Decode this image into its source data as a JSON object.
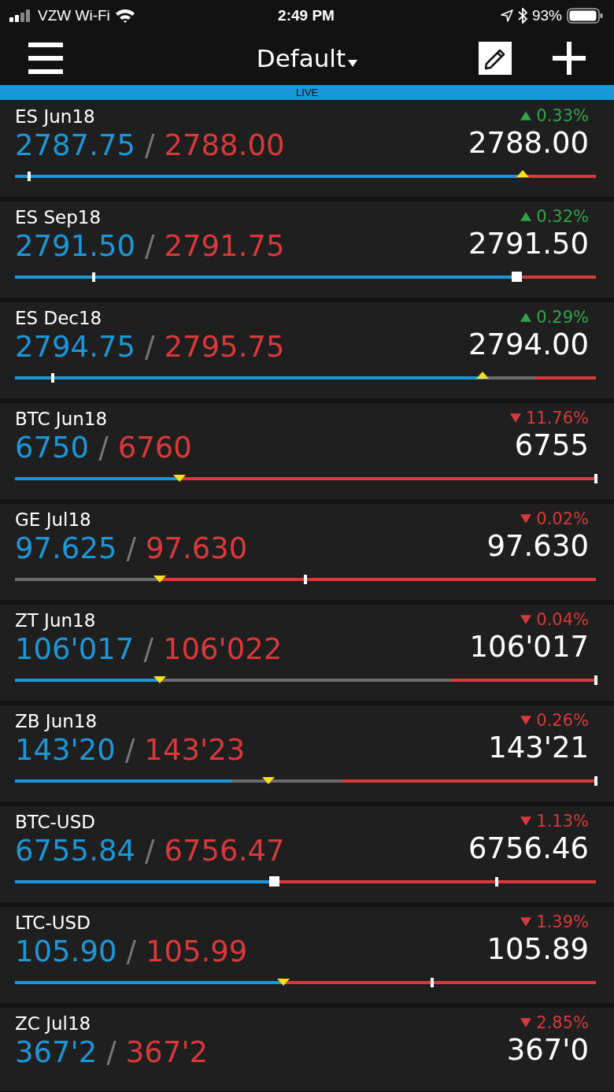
{
  "status_bar": {
    "carrier": "VZW Wi-Fi",
    "time": "2:49 PM",
    "battery": "93%"
  },
  "header": {
    "title": "Default"
  },
  "live_banner": {
    "label": "LIVE"
  },
  "quotes": [
    {
      "symbol": "ES Jun18",
      "bid": "2787.75",
      "separator": "/",
      "ask": "2788.00",
      "kind": "up",
      "change": "0.33%",
      "last": "2788.00",
      "bar": {
        "blue": {
          "level": 0.874
        },
        "red": {
          "level": 0.126
        },
        "marker": {
          "kind": "up-triangle",
          "level": 0.874
        },
        "tick": {
          "level": 0.024
        }
      }
    },
    {
      "symbol": "ES Sep18",
      "bid": "2791.50",
      "separator": "/",
      "ask": "2791.75",
      "kind": "up",
      "change": "0.32%",
      "last": "2791.50",
      "bar": {
        "blue": {
          "level": 0.864
        },
        "red": {
          "level": 0.136
        },
        "marker": {
          "kind": "square",
          "level": 0.864
        },
        "tick": {
          "level": 0.136
        }
      }
    },
    {
      "symbol": "ES Dec18",
      "bid": "2794.75",
      "separator": "/",
      "ask": "2795.75",
      "kind": "up",
      "change": "0.29%",
      "last": "2794.00",
      "bar": {
        "blue": {
          "level": 0.805
        },
        "red": {
          "level": 0.104
        },
        "marker": {
          "kind": "up-triangle",
          "level": 0.805
        },
        "tick": {
          "level": 0.065
        }
      }
    },
    {
      "symbol": "BTC Jun18",
      "bid": "6750",
      "separator": "/",
      "ask": "6760",
      "kind": "down",
      "change": "11.76%",
      "last": "6755",
      "bar": {
        "blue": {
          "level": 0.283
        },
        "red": {
          "level": 0.717
        },
        "marker": {
          "kind": "down-triangle",
          "level": 0.283
        },
        "tick": {
          "level": 1
        }
      }
    },
    {
      "symbol": "GE Jul18",
      "bid": "97.625",
      "separator": "/",
      "ask": "97.630",
      "kind": "down",
      "change": "0.02%",
      "last": "97.630",
      "bar": {
        "blue": {
          "level": 0
        },
        "red": {
          "level": 0.751
        },
        "marker": {
          "kind": "down-triangle",
          "level": 0.249
        },
        "tick": {
          "level": 0.5
        }
      }
    },
    {
      "symbol": "ZT Jun18",
      "bid": "106'017",
      "separator": "/",
      "ask": "106'022",
      "kind": "down",
      "change": "0.04%",
      "last": "106'017",
      "bar": {
        "blue": {
          "level": 0.249
        },
        "red": {
          "level": 0.25
        },
        "marker": {
          "kind": "down-triangle",
          "level": 0.249
        },
        "tick": {
          "level": 1
        }
      }
    },
    {
      "symbol": "ZB Jun18",
      "bid": "143'20",
      "separator": "/",
      "ask": "143'23",
      "kind": "down",
      "change": "0.26%",
      "last": "143'21",
      "bar": {
        "blue": {
          "level": 0.374
        },
        "red": {
          "level": 0.436
        },
        "marker": {
          "kind": "down-triangle",
          "level": 0.436
        },
        "tick": {
          "level": 1
        }
      }
    },
    {
      "symbol": "BTC-USD",
      "bid": "6755.84",
      "separator": "/",
      "ask": "6756.47",
      "kind": "down",
      "change": "1.13%",
      "last": "6756.46",
      "bar": {
        "blue": {
          "level": 0.446
        },
        "red": {
          "level": 0.554
        },
        "marker": {
          "kind": "square",
          "level": 0.446
        },
        "tick": {
          "level": 0.829
        }
      }
    },
    {
      "symbol": "LTC-USD",
      "bid": "105.90",
      "separator": "/",
      "ask": "105.99",
      "kind": "down",
      "change": "1.39%",
      "last": "105.89",
      "bar": {
        "blue": {
          "level": 0.462
        },
        "red": {
          "level": 0.538
        },
        "marker": {
          "kind": "down-triangle",
          "level": 0.462
        },
        "tick": {
          "level": 0.718
        }
      }
    },
    {
      "symbol": "ZC Jul18",
      "bid": "367'2",
      "separator": "/",
      "ask": "367'2",
      "kind": "down",
      "change": "2.85%",
      "last": "367'0"
    }
  ]
}
